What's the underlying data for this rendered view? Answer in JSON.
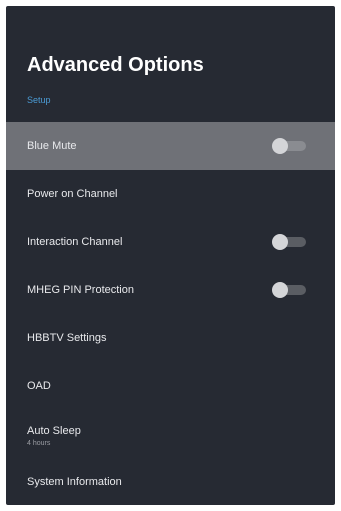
{
  "header": {
    "title": "Advanced Options",
    "breadcrumb": "Setup"
  },
  "menu": {
    "items": [
      {
        "label": "Blue Mute",
        "selected": true,
        "toggle": "off"
      },
      {
        "label": "Power on Channel"
      },
      {
        "label": "Interaction Channel",
        "toggle": "off"
      },
      {
        "label": "MHEG PIN Protection",
        "toggle": "off"
      },
      {
        "label": "HBBTV Settings"
      },
      {
        "label": "OAD"
      },
      {
        "label": "Auto Sleep",
        "value": "4 hours"
      },
      {
        "label": "System Information"
      }
    ]
  },
  "colors": {
    "background": "#262a33",
    "selected_row": "#6f7177",
    "breadcrumb": "#4b9bd4"
  }
}
